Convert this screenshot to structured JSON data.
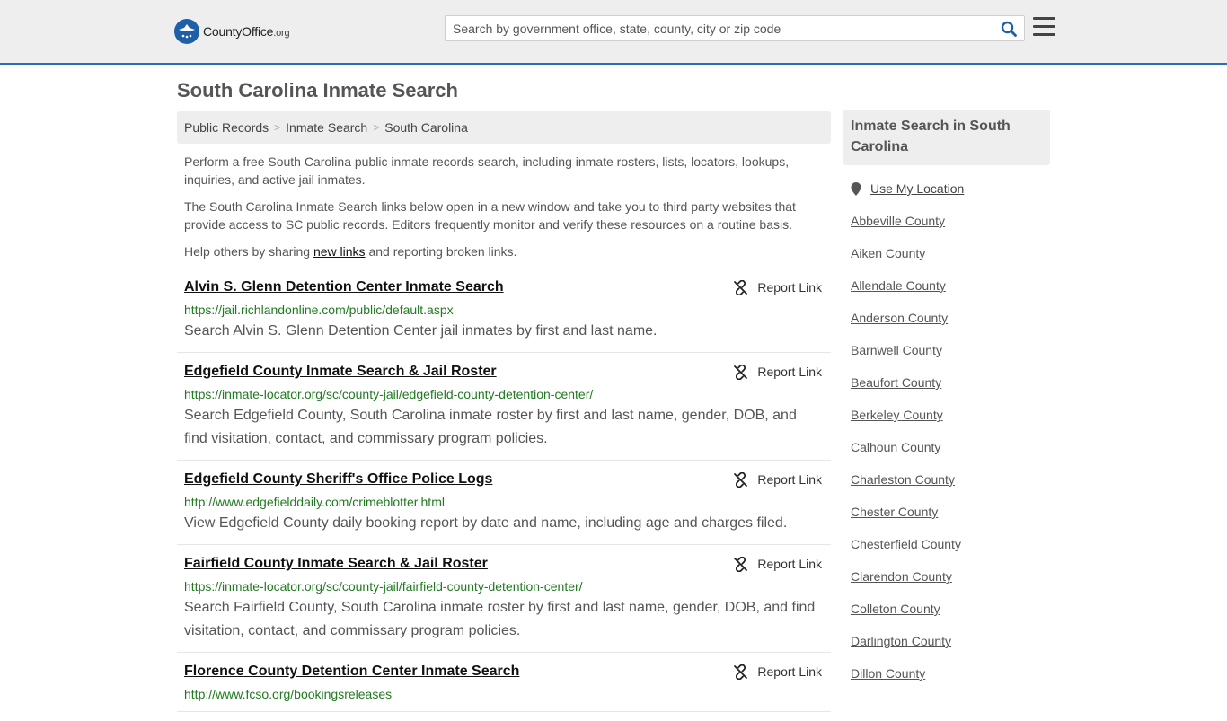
{
  "header": {
    "logo_text": "CountyOffice",
    "logo_suffix": ".org",
    "search_placeholder": "Search by government office, state, county, city or zip code"
  },
  "page": {
    "title": "South Carolina Inmate Search"
  },
  "breadcrumb": [
    "Public Records",
    "Inmate Search",
    "South Carolina"
  ],
  "intro": {
    "p1": "Perform a free South Carolina public inmate records search, including inmate rosters, lists, locators, lookups, inquiries, and active jail inmates.",
    "p2": "The South Carolina Inmate Search links below open in a new window and take you to third party websites that provide access to SC public records. Editors frequently monitor and verify these resources on a routine basis.",
    "p3_before": "Help others by sharing ",
    "p3_link": "new links",
    "p3_after": " and reporting broken links."
  },
  "report_label": "Report Link",
  "results": [
    {
      "title": "Alvin S. Glenn Detention Center Inmate Search",
      "url": "https://jail.richlandonline.com/public/default.aspx",
      "desc": "Search Alvin S. Glenn Detention Center jail inmates by first and last name."
    },
    {
      "title": "Edgefield County Inmate Search & Jail Roster",
      "url": "https://inmate-locator.org/sc/county-jail/edgefield-county-detention-center/",
      "desc": "Search Edgefield County, South Carolina inmate roster by first and last name, gender, DOB, and find visitation, contact, and commissary program policies."
    },
    {
      "title": "Edgefield County Sheriff's Office Police Logs",
      "url": "http://www.edgefielddaily.com/crimeblotter.html",
      "desc": "View Edgefield County daily booking report by date and name, including age and charges filed."
    },
    {
      "title": "Fairfield County Inmate Search & Jail Roster",
      "url": "https://inmate-locator.org/sc/county-jail/fairfield-county-detention-center/",
      "desc": "Search Fairfield County, South Carolina inmate roster by first and last name, gender, DOB, and find visitation, contact, and commissary program policies."
    },
    {
      "title": "Florence County Detention Center Inmate Search",
      "url": "http://www.fcso.org/bookingsreleases",
      "desc": ""
    }
  ],
  "sidebar": {
    "heading": "Inmate Search in South Carolina",
    "use_location": "Use My Location",
    "counties": [
      "Abbeville County",
      "Aiken County",
      "Allendale County",
      "Anderson County",
      "Barnwell County",
      "Beaufort County",
      "Berkeley County",
      "Calhoun County",
      "Charleston County",
      "Chester County",
      "Chesterfield County",
      "Clarendon County",
      "Colleton County",
      "Darlington County",
      "Dillon County"
    ]
  },
  "colors": {
    "accent": "#2a6ebb",
    "url_green": "#217a21",
    "header_bg": "#eeeeee"
  }
}
